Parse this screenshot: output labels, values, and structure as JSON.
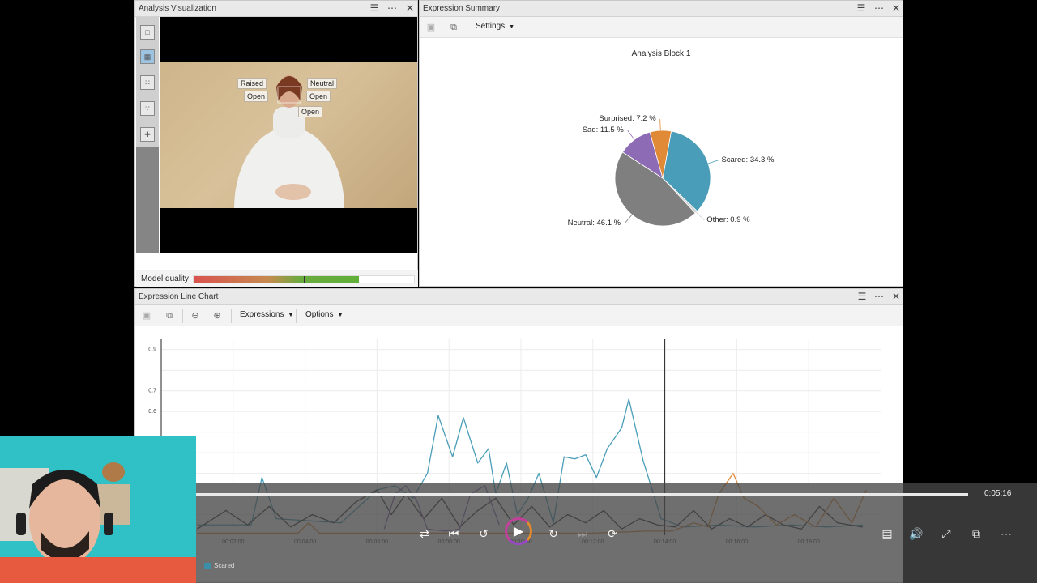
{
  "analysis_panel": {
    "title": "Analysis Visualization",
    "face_labels": [
      "Raised",
      "Neutral",
      "Open",
      "Open",
      "Open"
    ],
    "model_quality_label": "Model quality",
    "model_quality_level": 0.75,
    "model_quality_marker": 0.5
  },
  "summary_panel": {
    "title": "Expression Summary",
    "settings_label": "Settings",
    "chart_title": "Analysis Block 1"
  },
  "line_panel": {
    "title": "Expression Line Chart",
    "expressions_label": "Expressions",
    "options_label": "Options"
  },
  "player": {
    "time": "0:05:16",
    "progress": 1.0
  },
  "legend_label": "Scared",
  "colors": {
    "scared": "#4a9db8",
    "neutral": "#7f7f7f",
    "sad": "#8e6bb5",
    "surprised": "#e08a38",
    "other": "#cfcfcf",
    "dark_series": "#333333"
  },
  "chart_data": [
    {
      "type": "pie",
      "title": "Analysis Block 1",
      "slices": [
        {
          "name": "Scared",
          "value": 34.3,
          "label": "Scared: 34.3 %"
        },
        {
          "name": "Other",
          "value": 0.9,
          "label": "Other: 0.9 %"
        },
        {
          "name": "Neutral",
          "value": 46.1,
          "label": "Neutral: 46.1 %"
        },
        {
          "name": "Sad",
          "value": 11.5,
          "label": "Sad: 11.5 %"
        },
        {
          "name": "Surprised",
          "value": 7.2,
          "label": "Surprised: 7.2 %"
        }
      ]
    },
    {
      "type": "line",
      "y_ticks": [
        "0.9",
        "0.7",
        "0.6"
      ],
      "y_tick_values": [
        0.9,
        0.7,
        0.6
      ],
      "x_ticks": [
        "00:02:00",
        "00:04:00",
        "00:06:00",
        "00:08:00",
        "00:10:00",
        "00:12:00",
        "00:14:00",
        "00:16:00",
        "00:18:00"
      ],
      "x_tick_values": [
        2,
        4,
        6,
        8,
        10,
        12,
        14,
        16,
        18
      ],
      "xlim": [
        0,
        20
      ],
      "ylim": [
        0,
        0.95
      ],
      "cursor_x": 14,
      "series": [
        {
          "name": "Scared",
          "color": "#4a9db8",
          "x": [
            1,
            2.5,
            2.8,
            3.2,
            5,
            6,
            6.5,
            7,
            7.4,
            7.7,
            8.1,
            8.4,
            8.8,
            9.1,
            9.3,
            9.6,
            9.9,
            10.2,
            10.5,
            10.9,
            11.2,
            11.5,
            11.8,
            12.1,
            12.4,
            12.8,
            13,
            13.4,
            13.9,
            14.5,
            15.5,
            16.5,
            17.5,
            18.5,
            19.5
          ],
          "y": [
            0.05,
            0.05,
            0.28,
            0.08,
            0.06,
            0.22,
            0.24,
            0.18,
            0.3,
            0.58,
            0.38,
            0.57,
            0.35,
            0.42,
            0.2,
            0.35,
            0.1,
            0.18,
            0.3,
            0.06,
            0.38,
            0.37,
            0.39,
            0.28,
            0.42,
            0.52,
            0.66,
            0.36,
            0.08,
            0.04,
            0.05,
            0.04,
            0.05,
            0.04,
            0.05
          ]
        },
        {
          "name": "",
          "color": "#333333",
          "x": [
            1,
            1.8,
            2.4,
            3,
            3.6,
            4.2,
            4.8,
            5.4,
            6,
            6.4,
            6.8,
            7.3,
            7.8,
            8.3,
            8.8,
            9.3,
            9.8,
            10.3,
            10.8,
            11.3,
            11.8,
            12.3,
            12.8,
            13.3,
            13.8,
            14.3,
            14.8,
            15.3,
            15.8,
            16.3,
            16.8,
            17.3,
            17.8,
            18.3,
            18.8,
            19.5
          ],
          "y": [
            0.03,
            0.12,
            0.05,
            0.14,
            0.04,
            0.1,
            0.06,
            0.16,
            0.22,
            0.1,
            0.2,
            0.08,
            0.18,
            0.04,
            0.12,
            0.18,
            0.05,
            0.14,
            0.04,
            0.1,
            0.06,
            0.12,
            0.03,
            0.08,
            0.05,
            0.04,
            0.12,
            0.03,
            0.08,
            0.04,
            0.1,
            0.05,
            0.03,
            0.14,
            0.06,
            0.04
          ]
        },
        {
          "name": "",
          "color": "#e08a38",
          "x": [
            1,
            3.8,
            4.1,
            4.4,
            6,
            8,
            10,
            12,
            13.5,
            14.2,
            14.8,
            15.2,
            15.5,
            15.9,
            16.2,
            16.6,
            17.1,
            17.6,
            18.2,
            18.7,
            19.2,
            19.6
          ],
          "y": [
            0.01,
            0.01,
            0.06,
            0.01,
            0.01,
            0.01,
            0.01,
            0.01,
            0.02,
            0.02,
            0.06,
            0.04,
            0.2,
            0.3,
            0.18,
            0.14,
            0.05,
            0.1,
            0.04,
            0.18,
            0.06,
            0.22
          ]
        },
        {
          "name": "",
          "color": "#8e6bb5",
          "x": [
            6.2,
            6.5,
            6.8,
            7.1,
            7.4,
            7.9,
            8.3,
            8.6,
            9.0,
            9.4
          ],
          "y": [
            0.03,
            0.2,
            0.24,
            0.17,
            0.03,
            0.02,
            0.03,
            0.2,
            0.24,
            0.05
          ]
        }
      ]
    }
  ]
}
